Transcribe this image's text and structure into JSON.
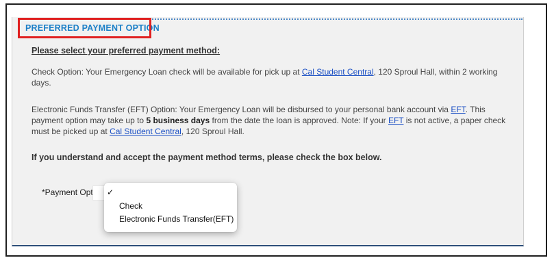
{
  "section": {
    "title": "PREFERRED PAYMENT OPTION"
  },
  "content": {
    "prompt": "Please select your preferred payment method:",
    "check_option": {
      "lead": "Check Option: Your Emergency Loan check will be available for pick up at ",
      "link": "Cal Student Central",
      "tail": ", 120 Sproul Hall, within 2 working days."
    },
    "eft_option": {
      "lead": "Electronic Funds Transfer (EFT) Option: Your Emergency Loan  will be disbursed to your personal bank account via ",
      "link1": "EFT",
      "mid1": ". This payment option may take up to ",
      "bold": "5 business days",
      "mid2": " from the date the loan is approved. Note: If your ",
      "link2": "EFT",
      "mid3": " is not active, a paper check must be picked up at ",
      "link3": "Cal Student Central",
      "tail": ", 120 Sproul Hall."
    },
    "accept_text": "If you understand and accept the payment method terms, please check the box below."
  },
  "payment_field": {
    "label": "*Payment Optio",
    "dropdown": {
      "selected_mark": "✓",
      "options": [
        "",
        "Check",
        "Electronic Funds Transfer(EFT)"
      ]
    }
  }
}
